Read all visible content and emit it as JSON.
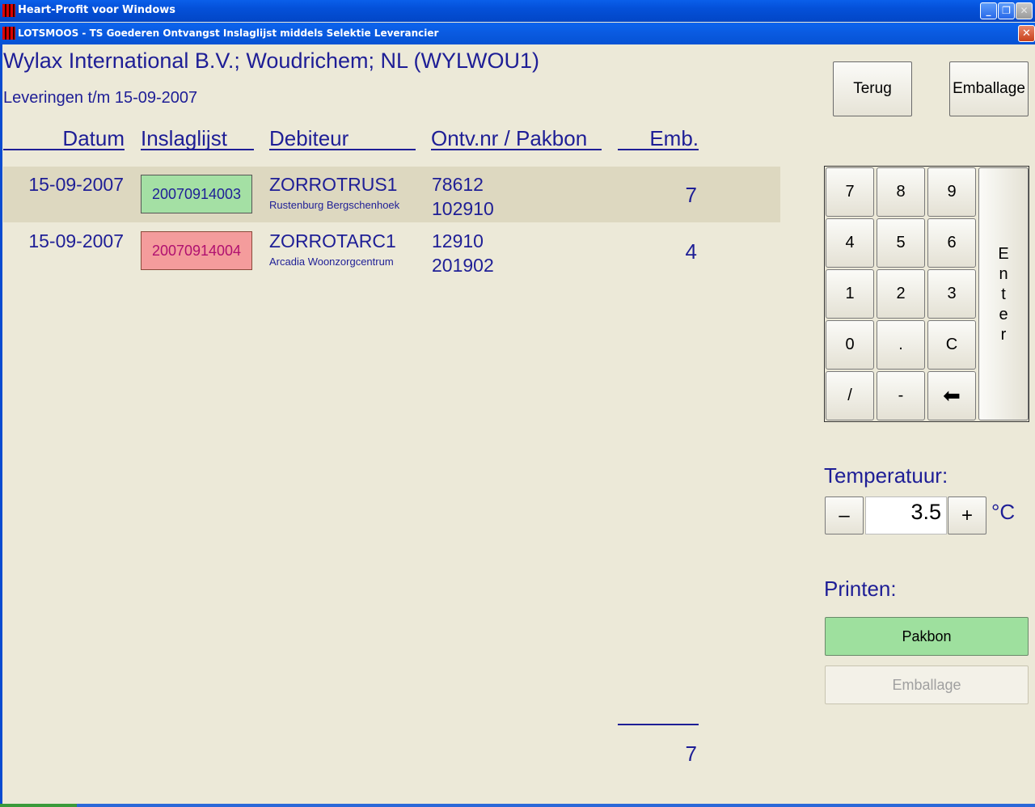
{
  "window": {
    "app_title": "Heart-Profit voor Windows",
    "child_title": "LOTSMOOS - TS Goederen Ontvangst Inslaglijst middels Selektie Leverancier",
    "minimize_glyph": "_",
    "restore_glyph": "❐",
    "close_glyph": "✕"
  },
  "header": {
    "supplier": "Wylax International B.V.; Woudrichem; NL (WYLWOU1)",
    "deliveries_until": "Leveringen t/m 15-09-2007"
  },
  "columns": {
    "datum": "Datum",
    "inslaglijst": "Inslaglijst",
    "debiteur": "Debiteur",
    "ontv": "Ontv.nr / Pakbon",
    "emb": "Emb."
  },
  "rows": [
    {
      "datum": "15-09-2007",
      "inslaglijst": "20070914003",
      "debiteur": "ZORROTRUS1",
      "debiteur_naam": "Rustenburg Bergschenhoek",
      "ontv_nr": "78612",
      "pakbon": "102910",
      "emb": "7",
      "status_color": "#a4e0a4"
    },
    {
      "datum": "15-09-2007",
      "inslaglijst": "20070914004",
      "debiteur": "ZORROTARC1",
      "debiteur_naam": "Arcadia Woonzorgcentrum",
      "ontv_nr": "12910",
      "pakbon": "201902",
      "emb": "4",
      "status_color": "#f49c9c"
    }
  ],
  "total": "7",
  "buttons": {
    "terug": "Terug",
    "emballage": "Emballage"
  },
  "keypad": {
    "keys": [
      "7",
      "8",
      "9",
      "4",
      "5",
      "6",
      "1",
      "2",
      "3",
      "0",
      ".",
      "C",
      "/",
      "-",
      "⬅"
    ],
    "enter_letters": [
      "E",
      "n",
      "t",
      "e",
      "r"
    ]
  },
  "temperature": {
    "label": "Temperatuur:",
    "minus": "–",
    "value": "3.5",
    "plus": "+",
    "unit": "°C"
  },
  "print": {
    "label": "Printen:",
    "pakbon": "Pakbon",
    "emballage": "Emballage"
  },
  "colors": {
    "text": "#1e1e96",
    "background": "#ece9d8",
    "selected_row": "#ddd8c0",
    "pakbon_button": "#9ee09e"
  }
}
